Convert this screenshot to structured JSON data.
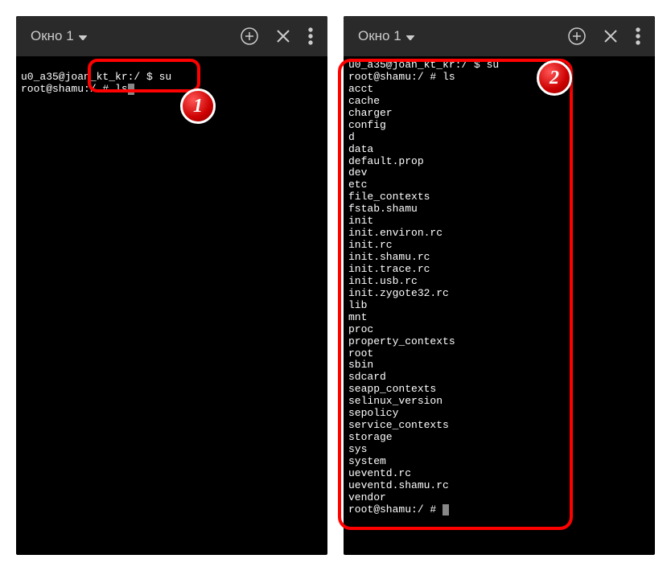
{
  "badges": {
    "one": "1",
    "two": "2"
  },
  "left": {
    "title": "Окно 1",
    "prompt1": "u0_a35@joan_kt_kr:/ $ su",
    "prompt2_prefix": "root@shamu:/ # ",
    "prompt2_cmd": "ls"
  },
  "right": {
    "title": "Окно 1",
    "prompt1": "u0_a35@joan_kt_kr:/ $ su",
    "prompt2": "root@shamu:/ # ls",
    "listing": [
      "acct",
      "cache",
      "charger",
      "config",
      "d",
      "data",
      "default.prop",
      "dev",
      "etc",
      "file_contexts",
      "fstab.shamu",
      "init",
      "init.environ.rc",
      "init.rc",
      "init.shamu.rc",
      "init.trace.rc",
      "init.usb.rc",
      "init.zygote32.rc",
      "lib",
      "mnt",
      "proc",
      "property_contexts",
      "root",
      "sbin",
      "sdcard",
      "seapp_contexts",
      "selinux_version",
      "sepolicy",
      "service_contexts",
      "storage",
      "sys",
      "system",
      "ueventd.rc",
      "ueventd.shamu.rc",
      "vendor"
    ],
    "prompt3_prefix": "root@shamu:/ # "
  }
}
